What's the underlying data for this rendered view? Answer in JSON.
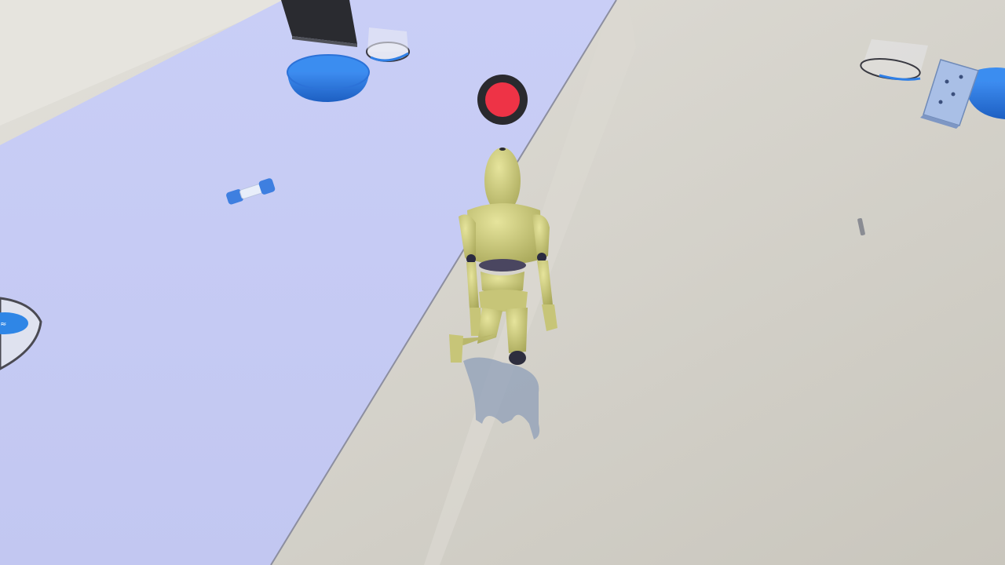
{
  "scene": {
    "view": "third-person",
    "colors": {
      "floor": "#d3d0c7",
      "mat": "#c8cdf6",
      "accent_blue": "#2f7fe6",
      "character": "#c9c77a",
      "marker_red": "#ee3346",
      "marker_ring": "#2a2a2e"
    }
  },
  "hud": {
    "target_marker_icon": "record-dot-icon"
  },
  "objects": [
    {
      "name": "blue-bowl-icon"
    },
    {
      "name": "tablet-icon"
    },
    {
      "name": "glass-container-icon"
    },
    {
      "name": "blue-bowl-icon"
    },
    {
      "name": "water-bottle-icon"
    },
    {
      "name": "die-icon"
    },
    {
      "name": "small-object-icon"
    },
    {
      "name": "humanoid-avatar-icon"
    }
  ]
}
